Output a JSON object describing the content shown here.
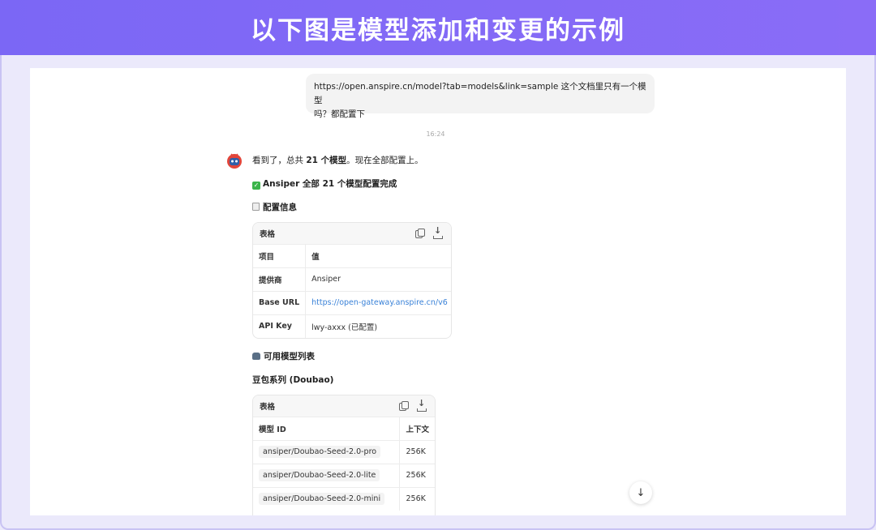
{
  "banner": {
    "title": "以下图是模型添加和变更的示例"
  },
  "user_message": {
    "line1": "https://open.anspire.cn/model?tab=models&link=sample  这个文档里只有一个模型",
    "line2": "吗？都配置下"
  },
  "timestamp": "16:24",
  "assistant": {
    "intro_prefix": "看到了，总共 ",
    "intro_bold": "21 个模型",
    "intro_suffix": "。现在全部配置上。",
    "done_heading": "Ansiper 全部 21 个模型配置完成",
    "config_heading": "配置信息",
    "config_table": {
      "title": "表格",
      "headers": [
        "项目",
        "值"
      ],
      "rows": [
        [
          "提供商",
          "Ansiper"
        ],
        [
          "Base URL",
          "https://open-gateway.anspire.cn/v6"
        ],
        [
          "API Key",
          "lwy-axxx (已配置)"
        ]
      ]
    },
    "models_heading": "可用模型列表",
    "series_heading": "豆包系列 (Doubao)",
    "models_table": {
      "title": "表格",
      "headers": [
        "模型 ID",
        "上下文"
      ],
      "rows": [
        [
          "ansiper/Doubao-Seed-2.0-pro",
          "256K"
        ],
        [
          "ansiper/Doubao-Seed-2.0-lite",
          "256K"
        ],
        [
          "ansiper/Doubao-Seed-2.0-mini",
          "256K"
        ]
      ]
    }
  },
  "icons": {
    "check": "check-mark-icon",
    "clipboard": "clipboard-icon",
    "robot": "robot-icon",
    "copy": "copy-icon",
    "download": "download-icon",
    "scroll": "arrow-down-icon"
  },
  "colors": {
    "banner": "#7b67f5",
    "link": "#3a82d8",
    "check": "#3bb44a"
  }
}
